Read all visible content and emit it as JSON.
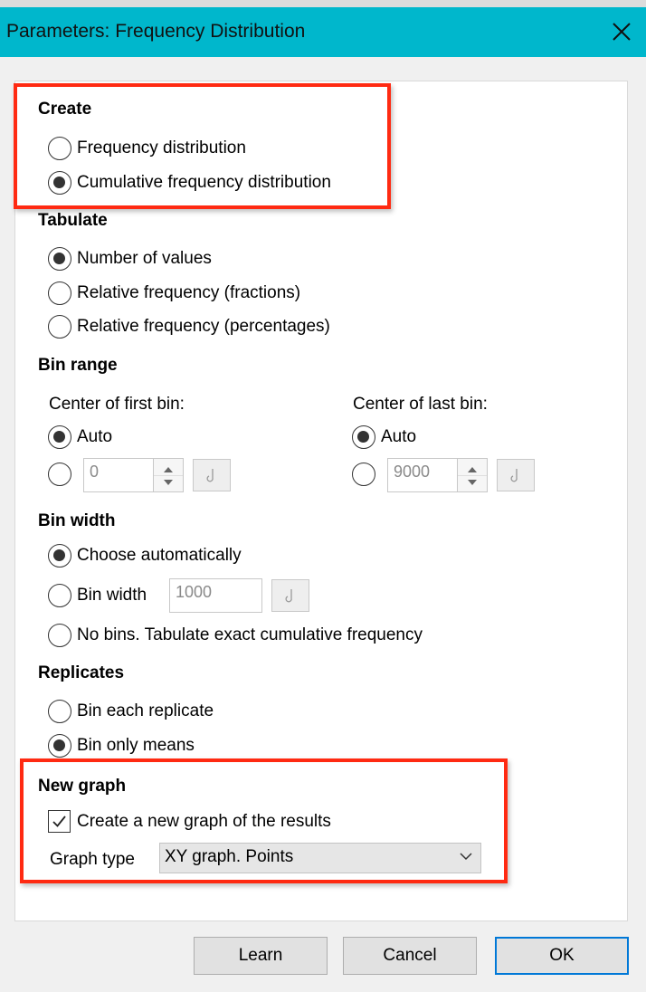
{
  "window": {
    "title": "Parameters: Frequency Distribution"
  },
  "create": {
    "title": "Create",
    "options": [
      {
        "label": "Frequency distribution",
        "selected": false
      },
      {
        "label": "Cumulative frequency distribution",
        "selected": true
      }
    ]
  },
  "tabulate": {
    "title": "Tabulate",
    "options": [
      {
        "label": "Number of values",
        "selected": true
      },
      {
        "label": "Relative frequency (fractions)",
        "selected": false
      },
      {
        "label": "Relative frequency (percentages)",
        "selected": false
      }
    ]
  },
  "bin_range": {
    "title": "Bin range",
    "first": {
      "label": "Center of first bin:",
      "auto_label": "Auto",
      "auto_selected": true,
      "value": "0"
    },
    "last": {
      "label": "Center of last bin:",
      "auto_label": "Auto",
      "auto_selected": true,
      "value": "9000"
    }
  },
  "bin_width": {
    "title": "Bin width",
    "auto_label": "Choose automatically",
    "width_label": "Bin width",
    "width_value": "1000",
    "nobins_label": "No bins. Tabulate exact cumulative frequency",
    "selected": "auto"
  },
  "replicates": {
    "title": "Replicates",
    "options": [
      {
        "label": "Bin each replicate",
        "selected": false
      },
      {
        "label": "Bin only means",
        "selected": true
      }
    ]
  },
  "new_graph": {
    "title": "New graph",
    "checkbox_label": "Create a new graph of the results",
    "checked": true,
    "graph_type_label": "Graph type",
    "graph_type_value": "XY graph. Points"
  },
  "buttons": {
    "learn": "Learn",
    "cancel": "Cancel",
    "ok": "OK"
  },
  "colors": {
    "titlebar": "#00b7cc",
    "highlight": "#ff2a12",
    "primary_border": "#0078d7"
  },
  "icons": {
    "close": "close-icon",
    "hook": "hook-icon",
    "dropdown": "chevron-down-icon",
    "check": "checkmark-icon"
  }
}
